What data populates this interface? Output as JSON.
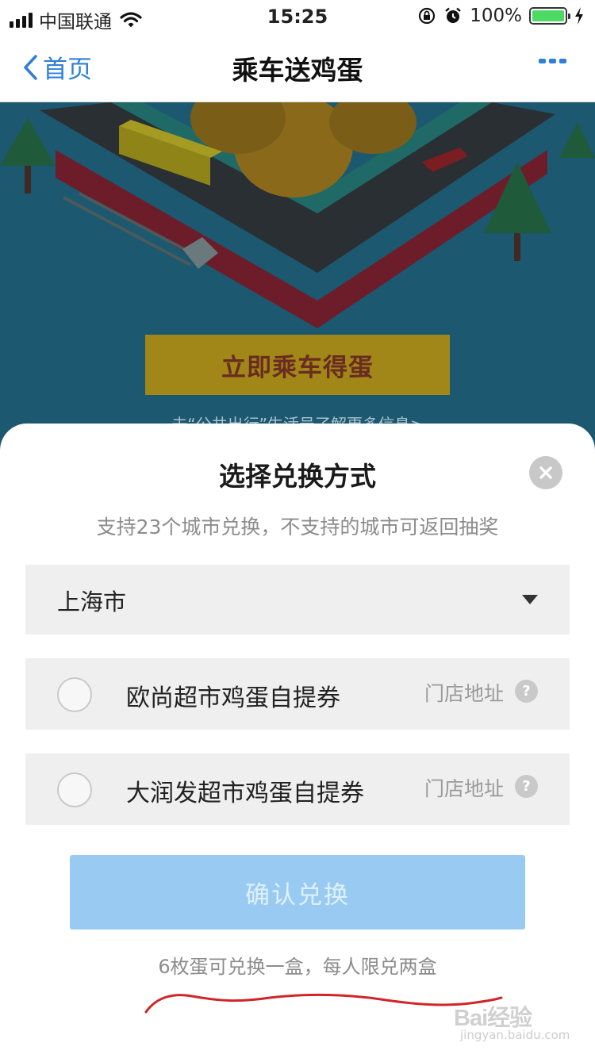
{
  "status_bar": {
    "carrier": "中国联通",
    "time": "15:25",
    "battery": "100%"
  },
  "nav": {
    "back_label": "首页",
    "title": "乘车送鸡蛋"
  },
  "banner": {
    "cta_label": "立即乘车得蛋",
    "link_text": "去“公共出行”生活号了解更多信息>"
  },
  "sheet": {
    "title": "选择兑换方式",
    "subtitle": "支持23个城市兑换，不支持的城市可返回抽奖",
    "city": "上海市",
    "options": [
      {
        "label": "欧尚超市鸡蛋自提券",
        "store_link": "门店地址",
        "help": "?"
      },
      {
        "label": "大润发超市鸡蛋自提券",
        "store_link": "门店地址",
        "help": "?"
      }
    ],
    "confirm_label": "确认兑换",
    "note": "6枚蛋可兑换一盒，每人限兑两盒"
  },
  "watermark": {
    "logo": "Bai经验",
    "url": "jingyan.baidu.com"
  },
  "colors": {
    "accent": "#2e7fd8",
    "confirm_disabled": "#99cbf2",
    "row_bg": "#efefef",
    "banner_bg": "#1c5870",
    "annotation_red": "#d0252a"
  }
}
